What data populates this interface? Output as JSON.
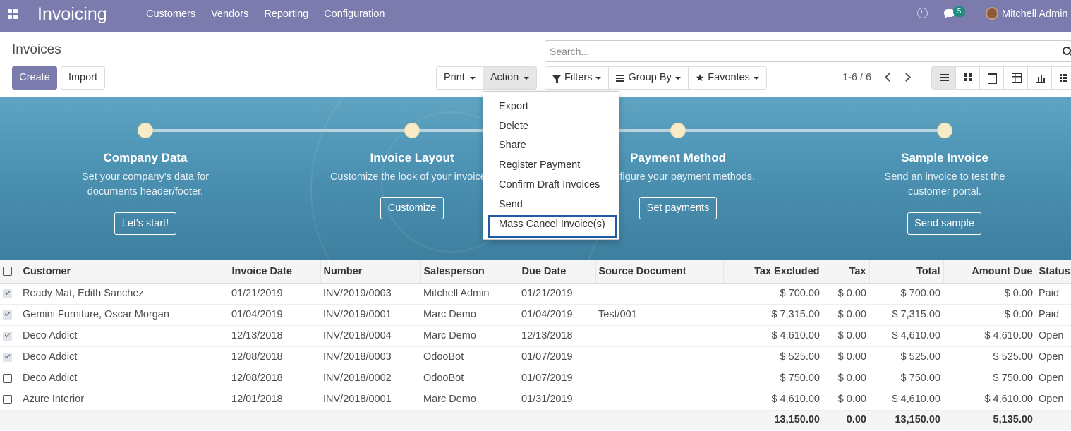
{
  "app": {
    "brand": "Invoicing",
    "menu": [
      "Customers",
      "Vendors",
      "Reporting",
      "Configuration"
    ],
    "chat_count": "5",
    "user_name": "Mitchell Admin"
  },
  "page": {
    "title": "Invoices",
    "search_placeholder": "Search...",
    "create_label": "Create",
    "import_label": "Import",
    "print_label": "Print",
    "action_label": "Action",
    "filters_label": "Filters",
    "groupby_label": "Group By",
    "favorites_label": "Favorites",
    "pager": "1-6 / 6"
  },
  "onboarding": {
    "steps": [
      {
        "title": "Company Data",
        "desc": "Set your company's data for documents header/footer.",
        "button": "Let's start!"
      },
      {
        "title": "Invoice Layout",
        "desc": "Customize the look of your invoices.",
        "button": "Customize"
      },
      {
        "title": "Payment Method",
        "desc": "Configure your payment methods.",
        "button": "Set payments"
      },
      {
        "title": "Sample Invoice",
        "desc": "Send an invoice to test the customer portal.",
        "button": "Send sample"
      }
    ]
  },
  "action_menu": [
    "Export",
    "Delete",
    "Share",
    "Register Payment",
    "Confirm Draft Invoices",
    "Send",
    "Mass Cancel Invoice(s)"
  ],
  "table": {
    "columns": [
      "Customer",
      "Invoice Date",
      "Number",
      "Salesperson",
      "Due Date",
      "Source Document",
      "Tax Excluded",
      "Tax",
      "Total",
      "Amount Due",
      "Status"
    ],
    "rows": [
      {
        "checked": true,
        "customer": "Ready Mat, Edith Sanchez",
        "date": "01/21/2019",
        "number": "INV/2019/0003",
        "salesperson": "Mitchell Admin",
        "due": "01/21/2019",
        "source": "",
        "untaxed": "$ 700.00",
        "tax": "$ 0.00",
        "total": "$ 700.00",
        "due_amount": "$ 0.00",
        "status": "Paid"
      },
      {
        "checked": true,
        "customer": "Gemini Furniture, Oscar Morgan",
        "date": "01/04/2019",
        "number": "INV/2019/0001",
        "salesperson": "Marc Demo",
        "due": "01/04/2019",
        "source": "Test/001",
        "untaxed": "$ 7,315.00",
        "tax": "$ 0.00",
        "total": "$ 7,315.00",
        "due_amount": "$ 0.00",
        "status": "Paid"
      },
      {
        "checked": true,
        "customer": "Deco Addict",
        "date": "12/13/2018",
        "number": "INV/2018/0004",
        "salesperson": "Marc Demo",
        "due": "12/13/2018",
        "source": "",
        "untaxed": "$ 4,610.00",
        "tax": "$ 0.00",
        "total": "$ 4,610.00",
        "due_amount": "$ 4,610.00",
        "status": "Open"
      },
      {
        "checked": true,
        "customer": "Deco Addict",
        "date": "12/08/2018",
        "number": "INV/2018/0003",
        "salesperson": "OdooBot",
        "due": "01/07/2019",
        "source": "",
        "untaxed": "$ 525.00",
        "tax": "$ 0.00",
        "total": "$ 525.00",
        "due_amount": "$ 525.00",
        "status": "Open"
      },
      {
        "checked": false,
        "customer": "Deco Addict",
        "date": "12/08/2018",
        "number": "INV/2018/0002",
        "salesperson": "OdooBot",
        "due": "01/07/2019",
        "source": "",
        "untaxed": "$ 750.00",
        "tax": "$ 0.00",
        "total": "$ 750.00",
        "due_amount": "$ 750.00",
        "status": "Open"
      },
      {
        "checked": false,
        "customer": "Azure Interior",
        "date": "12/01/2018",
        "number": "INV/2018/0001",
        "salesperson": "Marc Demo",
        "due": "01/31/2019",
        "source": "",
        "untaxed": "$ 4,610.00",
        "tax": "$ 0.00",
        "total": "$ 4,610.00",
        "due_amount": "$ 4,610.00",
        "status": "Open"
      }
    ],
    "totals": {
      "untaxed": "13,150.00",
      "tax": "0.00",
      "total": "13,150.00",
      "due_amount": "5,135.00"
    }
  },
  "colors": {
    "brand": "#7c7bad",
    "highlight": "#1f5aa6",
    "banner": "#4d93b4"
  }
}
